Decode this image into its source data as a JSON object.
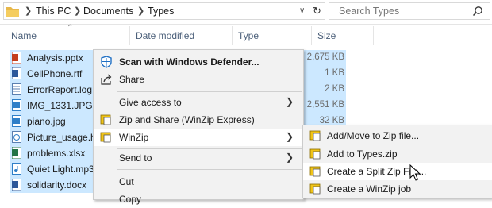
{
  "address": {
    "crumbs": [
      "This PC",
      "Documents",
      "Types"
    ],
    "search_placeholder": "Search Types"
  },
  "columns": {
    "name": "Name",
    "date": "Date modified",
    "type": "Type",
    "size": "Size"
  },
  "files": [
    {
      "name": "Analysis.pptx",
      "size": "2,675 KB",
      "icon": "powerpoint-file-icon",
      "color": "#c43e1c"
    },
    {
      "name": "CellPhone.rtf",
      "size": "1 KB",
      "icon": "word-file-icon",
      "color": "#2b579a"
    },
    {
      "name": "ErrorReport.log",
      "size": "2 KB",
      "icon": "text-file-icon",
      "color": "#5a7fb0"
    },
    {
      "name": "IMG_1331.JPG",
      "size": "2,551 KB",
      "icon": "image-file-icon",
      "color": "#2f7fc8"
    },
    {
      "name": "piano.jpg",
      "size": "32 KB",
      "icon": "image-file-icon",
      "color": "#2f7fc8"
    },
    {
      "name": "Picture_usage.ht",
      "size": "",
      "icon": "web-file-icon",
      "color": "#5a7fb0"
    },
    {
      "name": "problems.xlsx",
      "size": "",
      "icon": "excel-file-icon",
      "color": "#217346"
    },
    {
      "name": "Quiet Light.mp3",
      "size": "",
      "icon": "audio-file-icon",
      "color": "#2f7fc8"
    },
    {
      "name": "solidarity.docx",
      "size": "",
      "icon": "word-file-icon",
      "color": "#2b579a"
    }
  ],
  "context_menu": {
    "items": [
      {
        "label": "Scan with Windows Defender...",
        "icon": "windows-defender-icon"
      },
      {
        "label": "Share",
        "icon": "share-icon"
      },
      {
        "label": "Give access to",
        "icon": "",
        "submenu": true
      },
      {
        "label": "Zip and Share (WinZip Express)",
        "icon": "winzip-icon"
      },
      {
        "label": "WinZip",
        "icon": "winzip-icon",
        "submenu": true,
        "highlighted": true
      },
      {
        "label": "Send to",
        "icon": "",
        "submenu": true
      },
      {
        "label": "Cut",
        "icon": ""
      },
      {
        "label": "Copy",
        "icon": ""
      }
    ]
  },
  "winzip_submenu": {
    "items": [
      {
        "label": "Add/Move to Zip file...",
        "icon": "winzip-icon"
      },
      {
        "label": "Add to Types.zip",
        "icon": "winzip-icon"
      },
      {
        "label": "Create a Split Zip File...",
        "icon": "winzip-icon",
        "highlighted": true
      },
      {
        "label": "Create a WinZip job",
        "icon": "winzip-icon"
      }
    ]
  },
  "colors": {
    "selection": "#cce8ff",
    "menu_bg": "#f2f2f2",
    "menu_highlight": "#ffffff",
    "header_text": "#4c607a"
  }
}
